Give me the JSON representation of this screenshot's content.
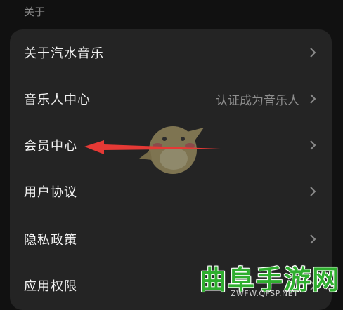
{
  "section": {
    "label": "关于"
  },
  "settings": {
    "items": [
      {
        "label": "关于汽水音乐",
        "sub": ""
      },
      {
        "label": "音乐人中心",
        "sub": "认证成为音乐人"
      },
      {
        "label": "会员中心",
        "sub": ""
      },
      {
        "label": "用户协议",
        "sub": ""
      },
      {
        "label": "隐私政策",
        "sub": ""
      },
      {
        "label": "应用权限",
        "sub": ""
      }
    ]
  },
  "watermark": {
    "title": "曲阜手游网",
    "url": "ZWFW.QFSP.NET"
  },
  "colors": {
    "background": "#111111",
    "card": "#242424",
    "arrow": "#e53935",
    "watermark": "#2fae2f"
  },
  "icons": {
    "chevron": "chevron-right-icon",
    "annotation": "red-arrow-icon",
    "mascot": "bird-mascot-icon"
  }
}
